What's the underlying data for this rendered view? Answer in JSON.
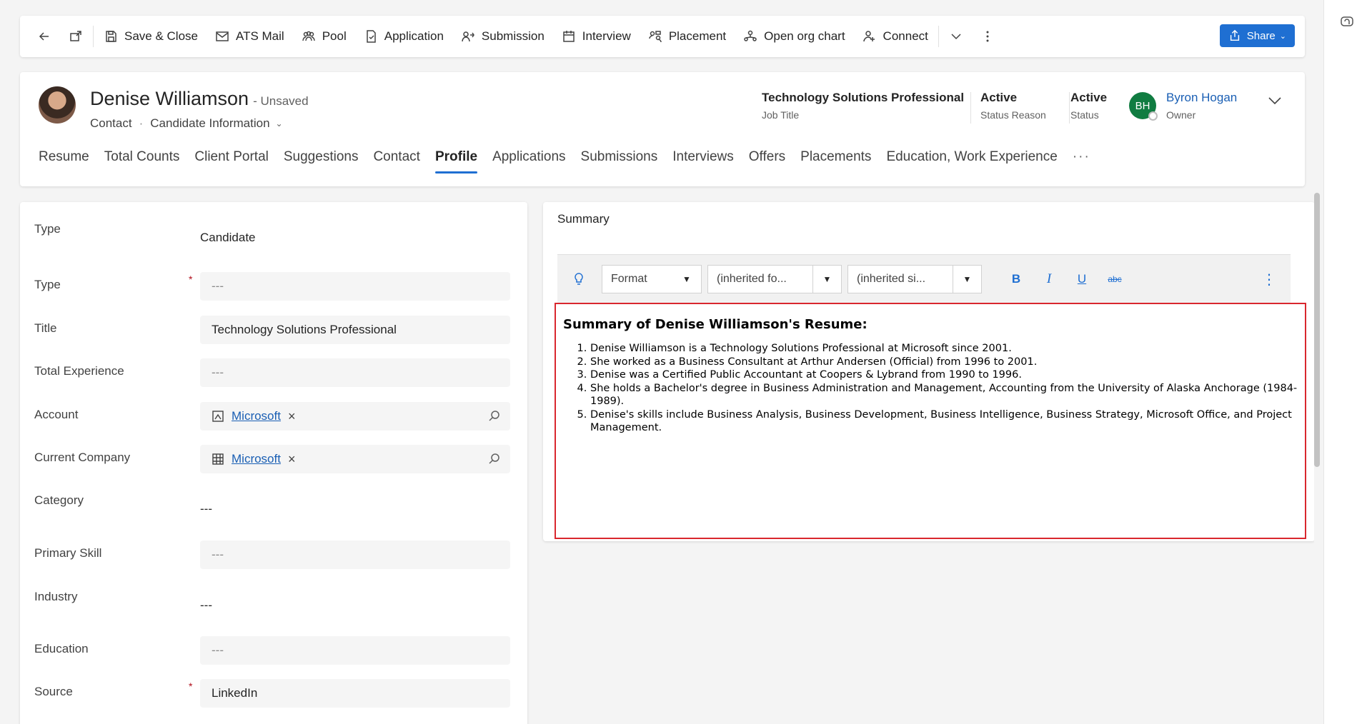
{
  "command_bar": {
    "back_label": "",
    "popout_label": "",
    "save_close": "Save & Close",
    "ats_mail": "ATS Mail",
    "pool": "Pool",
    "application": "Application",
    "submission": "Submission",
    "interview": "Interview",
    "placement": "Placement",
    "open_org_chart": "Open org chart",
    "connect": "Connect",
    "share": "Share"
  },
  "header": {
    "name": "Denise Williamson",
    "unsaved": "- Unsaved",
    "entity": "Contact",
    "form_selector": "Candidate Information",
    "job_title_value": "Technology Solutions Professional",
    "job_title_label": "Job Title",
    "status_reason_value": "Active",
    "status_reason_label": "Status Reason",
    "status_value": "Active",
    "status_label": "Status",
    "owner_initials": "BH",
    "owner_name": "Byron Hogan",
    "owner_label": "Owner"
  },
  "tabs": [
    {
      "label": "Resume"
    },
    {
      "label": "Total Counts"
    },
    {
      "label": "Client Portal"
    },
    {
      "label": "Suggestions"
    },
    {
      "label": "Contact"
    },
    {
      "label": "Profile"
    },
    {
      "label": "Applications"
    },
    {
      "label": "Submissions"
    },
    {
      "label": "Interviews"
    },
    {
      "label": "Offers"
    },
    {
      "label": "Placements"
    },
    {
      "label": "Education, Work Experience"
    },
    {
      "label": "···"
    }
  ],
  "form": {
    "type1_label": "Type",
    "type1_value": "Candidate",
    "type2_label": "Type",
    "type2_value": "---",
    "title_label": "Title",
    "title_value": "Technology Solutions Professional",
    "total_exp_label": "Total Experience",
    "total_exp_value": "---",
    "account_label": "Account",
    "account_value": "Microsoft",
    "current_company_label": "Current Company",
    "current_company_value": "Microsoft",
    "category_label": "Category",
    "category_value": "---",
    "primary_skill_label": "Primary Skill",
    "primary_skill_value": "---",
    "industry_label": "Industry",
    "industry_value": "---",
    "education_label": "Education",
    "education_value": "---",
    "source_label": "Source",
    "source_value": "LinkedIn",
    "required_marker": "*",
    "remove_glyph": "×"
  },
  "summary": {
    "title": "Summary",
    "toolbar": {
      "format": "Format",
      "font": "(inherited fo...",
      "size": "(inherited si...",
      "bold": "B",
      "italic": "I",
      "underline": "U",
      "strike": "abc",
      "more": "⋮"
    },
    "heading": "Summary of Denise Williamson's Resume:",
    "items": [
      "Denise Williamson is a Technology Solutions Professional at Microsoft since 2001.",
      "She worked as a Business Consultant at Arthur Andersen (Official) from 1996 to 2001.",
      "Denise was a Certified Public Accountant at Coopers & Lybrand from 1990 to 1996.",
      "She holds a Bachelor's degree in Business Administration and Management, Accounting from the University of Alaska Anchorage (1984-1989).",
      "Denise's skills include Business Analysis, Business Development, Business Intelligence, Business Strategy, Microsoft Office, and Project Management."
    ]
  },
  "colors": {
    "accent": "#1f6fd2",
    "link": "#1a5fb4",
    "owner_avatar": "#107c41",
    "editor_border": "#d9272e"
  }
}
